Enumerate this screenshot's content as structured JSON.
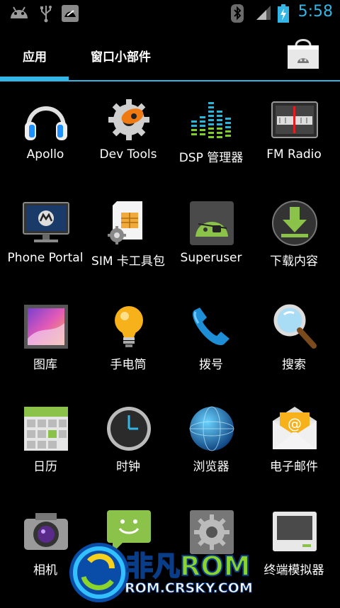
{
  "status": {
    "time": "5:58"
  },
  "tabs": [
    {
      "label": "应用"
    },
    {
      "label": "窗口小部件"
    }
  ],
  "apps": [
    {
      "label": "Apollo",
      "icon": "headphones-icon"
    },
    {
      "label": "Dev Tools",
      "icon": "gear-tools-icon"
    },
    {
      "label": "DSP 管理器",
      "icon": "equalizer-icon"
    },
    {
      "label": "FM Radio",
      "icon": "radio-icon"
    },
    {
      "label": "Phone Portal",
      "icon": "monitor-icon"
    },
    {
      "label": "SIM 卡工具包",
      "icon": "sim-card-icon"
    },
    {
      "label": "Superuser",
      "icon": "android-pirate-icon"
    },
    {
      "label": "下载内容",
      "icon": "download-icon"
    },
    {
      "label": "图库",
      "icon": "gallery-icon"
    },
    {
      "label": "手电筒",
      "icon": "lightbulb-icon"
    },
    {
      "label": "拨号",
      "icon": "phone-icon"
    },
    {
      "label": "搜索",
      "icon": "magnifier-icon"
    },
    {
      "label": "日历",
      "icon": "calendar-icon"
    },
    {
      "label": "时钟",
      "icon": "clock-icon"
    },
    {
      "label": "浏览器",
      "icon": "globe-icon"
    },
    {
      "label": "电子邮件",
      "icon": "email-icon"
    },
    {
      "label": "相机",
      "icon": "camera-icon"
    },
    {
      "label": "",
      "icon": "sms-icon"
    },
    {
      "label": "",
      "icon": "settings-icon"
    },
    {
      "label": "终端模拟器",
      "icon": "terminal-icon"
    }
  ],
  "watermark": {
    "brand": "非凡ROM",
    "url": "ROM.CRSKY.COM"
  },
  "colors": {
    "accent": "#33b5e5"
  }
}
